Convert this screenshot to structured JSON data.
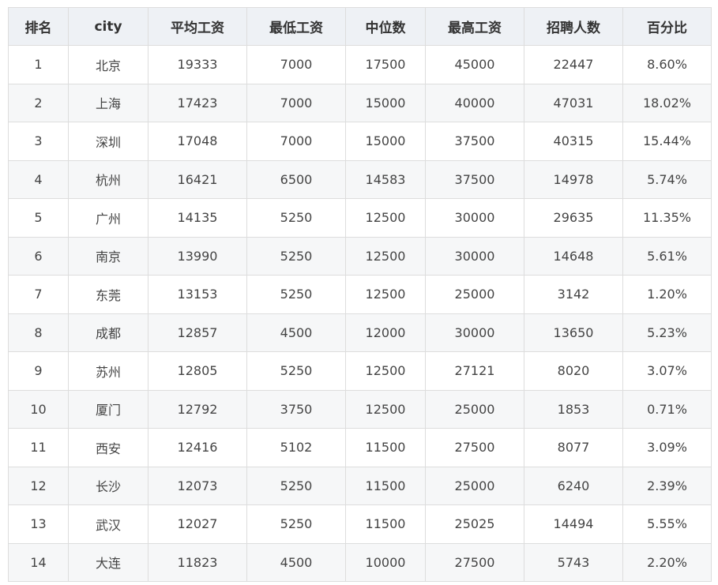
{
  "table": {
    "headers": [
      "排名",
      "city",
      "平均工资",
      "最低工资",
      "中位数",
      "最高工资",
      "招聘人数",
      "百分比"
    ],
    "rows": [
      [
        "1",
        "北京",
        "19333",
        "7000",
        "17500",
        "45000",
        "22447",
        "8.60%"
      ],
      [
        "2",
        "上海",
        "17423",
        "7000",
        "15000",
        "40000",
        "47031",
        "18.02%"
      ],
      [
        "3",
        "深圳",
        "17048",
        "7000",
        "15000",
        "37500",
        "40315",
        "15.44%"
      ],
      [
        "4",
        "杭州",
        "16421",
        "6500",
        "14583",
        "37500",
        "14978",
        "5.74%"
      ],
      [
        "5",
        "广州",
        "14135",
        "5250",
        "12500",
        "30000",
        "29635",
        "11.35%"
      ],
      [
        "6",
        "南京",
        "13990",
        "5250",
        "12500",
        "30000",
        "14648",
        "5.61%"
      ],
      [
        "7",
        "东莞",
        "13153",
        "5250",
        "12500",
        "25000",
        "3142",
        "1.20%"
      ],
      [
        "8",
        "成都",
        "12857",
        "4500",
        "12000",
        "30000",
        "13650",
        "5.23%"
      ],
      [
        "9",
        "苏州",
        "12805",
        "5250",
        "12500",
        "27121",
        "8020",
        "3.07%"
      ],
      [
        "10",
        "厦门",
        "12792",
        "3750",
        "12500",
        "25000",
        "1853",
        "0.71%"
      ],
      [
        "11",
        "西安",
        "12416",
        "5102",
        "11500",
        "27500",
        "8077",
        "3.09%"
      ],
      [
        "12",
        "长沙",
        "12073",
        "5250",
        "11500",
        "25000",
        "6240",
        "2.39%"
      ],
      [
        "13",
        "武汉",
        "12027",
        "5250",
        "11500",
        "25025",
        "14494",
        "5.55%"
      ],
      [
        "14",
        "大连",
        "11823",
        "4500",
        "10000",
        "27500",
        "5743",
        "2.20%"
      ]
    ]
  }
}
